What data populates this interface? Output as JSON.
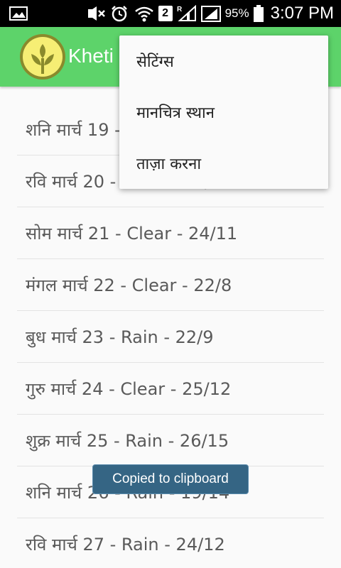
{
  "status_bar": {
    "battery_percent": "95%",
    "time": "3:07 PM",
    "sim_badge": "2",
    "icons": [
      "image-icon",
      "mute-icon",
      "alarm-icon",
      "wifi-icon",
      "sim-2-icon",
      "signal-icon",
      "signal-icon",
      "battery-icon"
    ]
  },
  "app_bar": {
    "title": "Kheti",
    "colors": {
      "bar": "#5dd36a",
      "logo_bg": "#8a8a2c",
      "logo_leaf": "#f6ee74"
    }
  },
  "overflow_menu": {
    "items": [
      {
        "label": "सेटिंग्स"
      },
      {
        "label": "मानचित्र स्थान"
      },
      {
        "label": "ताज़ा करना"
      }
    ]
  },
  "forecast": {
    "items": [
      {
        "text": "शनि मार्च 19 - Clear - 24/10"
      },
      {
        "text": "रवि मार्च 20 - Clear - 25/11"
      },
      {
        "text": "सोम मार्च 21 - Clear - 24/11"
      },
      {
        "text": "मंगल मार्च 22 - Clear - 22/8"
      },
      {
        "text": "बुध मार्च 23 - Rain - 22/9"
      },
      {
        "text": "गुरु मार्च 24 - Clear - 25/12"
      },
      {
        "text": "शुक्र मार्च 25 - Rain - 26/15"
      },
      {
        "text": "शनि मार्च 26 - Rain - 19/14"
      },
      {
        "text": "रवि मार्च 27 - Rain - 24/12"
      }
    ]
  },
  "toast": {
    "message": "Copied to clipboard",
    "color": "#356584"
  }
}
